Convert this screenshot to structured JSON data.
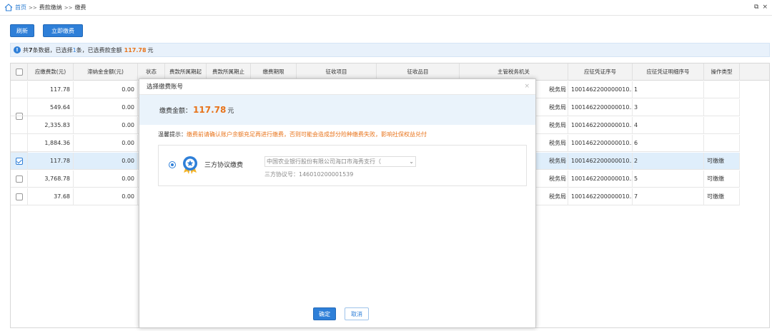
{
  "breadcrumb": {
    "home": "首页",
    "sep": ">>",
    "level1": "费款缴纳",
    "current": "缴费"
  },
  "window_controls": {
    "restore": "⧉",
    "close": "×"
  },
  "toolbar": {
    "refresh": "刷新",
    "pay_now": "立即缴费"
  },
  "info": {
    "prefix": "共",
    "total": "7",
    "mid1": "条数据，已选择",
    "selected": "1",
    "mid2": "条，已选费款金额",
    "amount": "117.78",
    "unit": "元"
  },
  "table": {
    "columns": [
      "应缴费款(元)",
      "滞纳金金额(元)",
      "状态",
      "费款所属期起",
      "费款所属期止",
      "缴费期限",
      "征收项目",
      "征收品目",
      "主管税务机关",
      "应征凭证序号",
      "应征凭证明细序号",
      "操作类型"
    ],
    "rows": [
      {
        "amount": "117.78",
        "late_fee": "0.00",
        "office": "税务局",
        "voucher": "1001462200000010...",
        "detail": "1",
        "op": "",
        "checked": false
      },
      {
        "amount": "549.64",
        "late_fee": "0.00",
        "office": "税务局",
        "voucher": "1001462200000010...",
        "detail": "3",
        "op": "",
        "checked": false
      },
      {
        "amount": "2,335.83",
        "late_fee": "0.00",
        "office": "税务局",
        "voucher": "1001462200000010...",
        "detail": "4",
        "op": "",
        "checked": false
      },
      {
        "amount": "1,884.36",
        "late_fee": "0.00",
        "office": "税务局",
        "voucher": "1001462200000010...",
        "detail": "6",
        "op": "",
        "checked": false
      },
      {
        "amount": "117.78",
        "late_fee": "0.00",
        "office": "税务局",
        "voucher": "1001462200000010...",
        "detail": "2",
        "op": "可缴缴",
        "checked": true
      },
      {
        "amount": "3,768.78",
        "late_fee": "0.00",
        "office": "税务局",
        "voucher": "1001462200000010...",
        "detail": "5",
        "op": "可缴缴",
        "checked": false
      },
      {
        "amount": "37.68",
        "late_fee": "0.00",
        "office": "税务局",
        "voucher": "1001462200000010...",
        "detail": "7",
        "op": "可缴缴",
        "checked": false
      }
    ]
  },
  "modal": {
    "title": "选择缴费账号",
    "close": "×",
    "amount_label": "缴费金额：",
    "amount_value": "117.78",
    "amount_unit": "元",
    "tip_label": "温馨提示：",
    "tip_text": "缴费前请确认账户余额充足再进行缴费，否则可能会造成部分险种缴费失败，影响社保权益兑付",
    "method": "三方协议缴费",
    "bank": "中国农业银行股份有限公司海口市海秀支行（",
    "account_label": "三方协议号：",
    "account_no": "146010200001539",
    "ok": "确定",
    "cancel": "取消"
  },
  "colors": {
    "accent": "#2e7fd8",
    "highlight": "#e8731a",
    "selected_row": "#dfeefb"
  }
}
